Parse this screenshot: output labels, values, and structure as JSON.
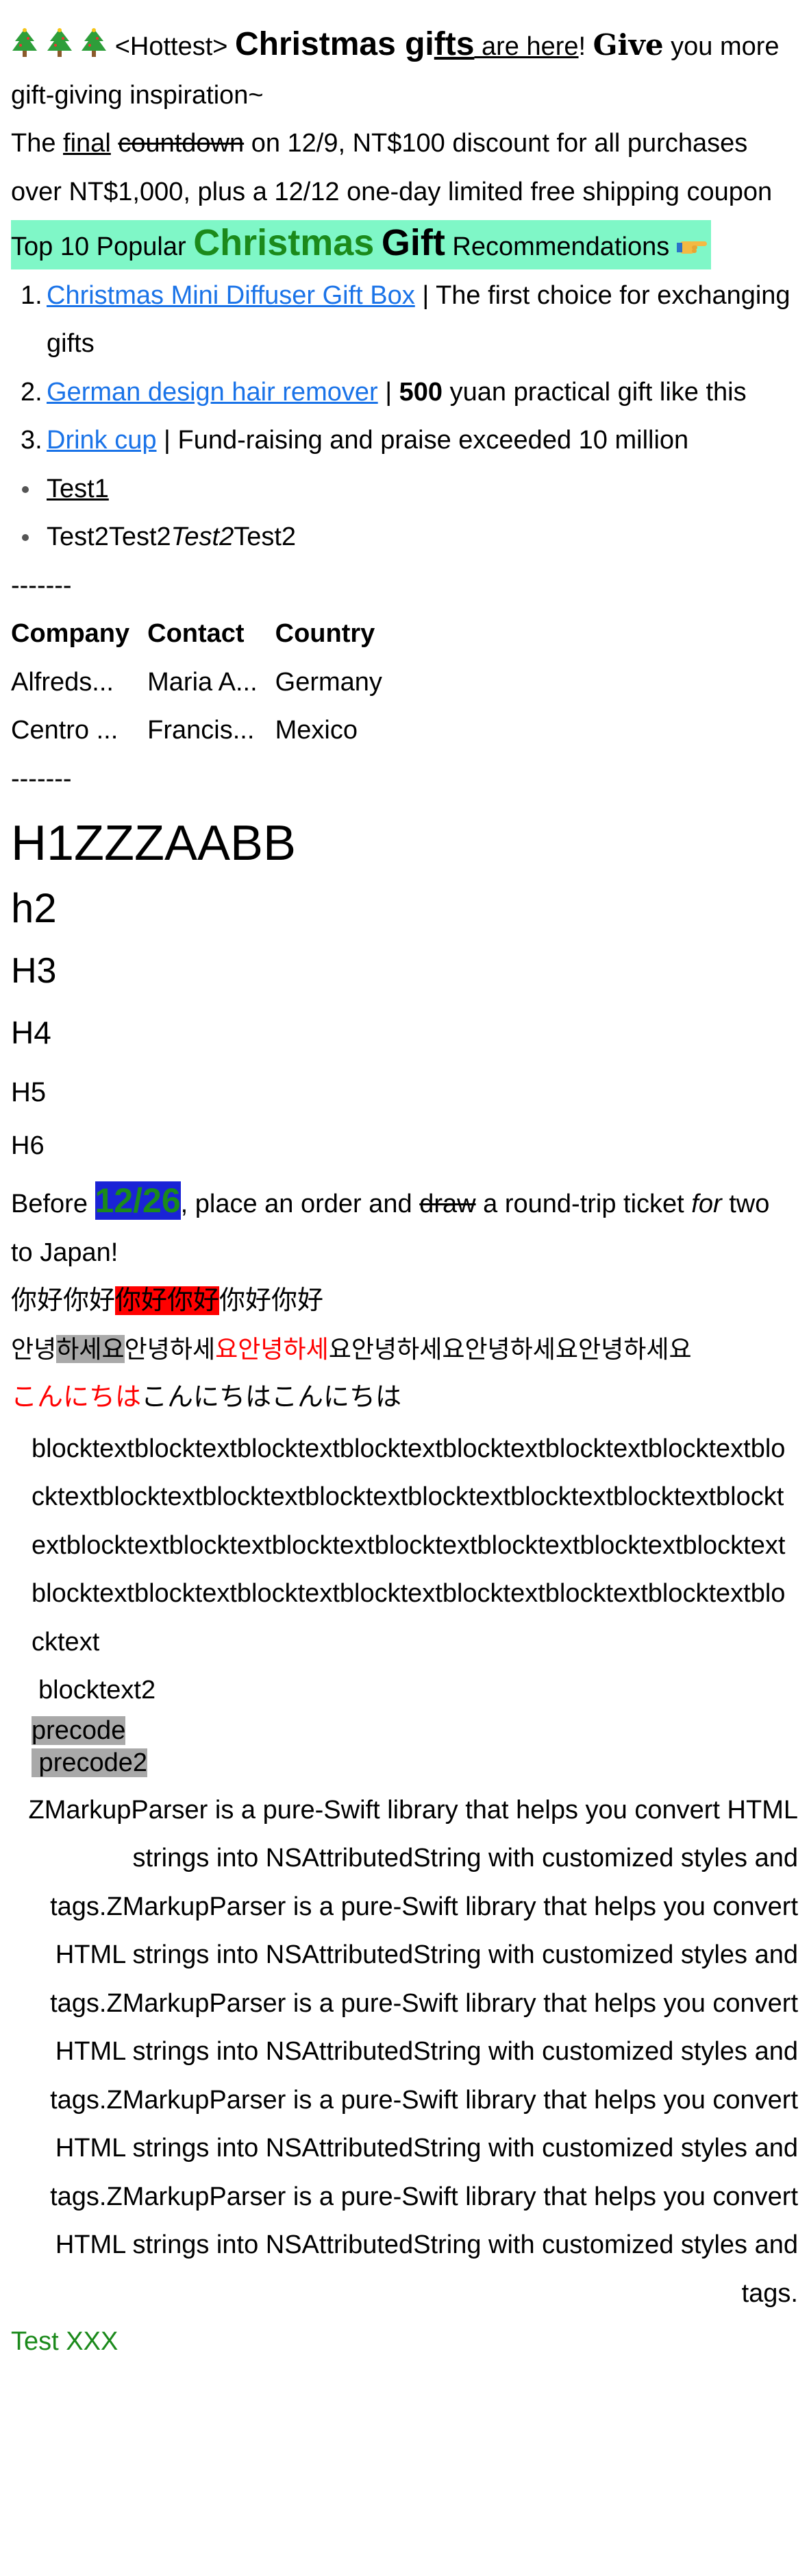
{
  "intro": {
    "icons": [
      "christmas-tree-icon",
      "christmas-tree-icon",
      "christmas-tree-icon"
    ],
    "tag": "<Hottest>",
    "christmas": "Christmas gi",
    "fts": "fts",
    "are_here": " are here",
    "bang": "!",
    "give": "Give",
    "rest": " you more gift-giving inspiration~"
  },
  "countdown": {
    "the": "The ",
    "final": "final",
    "countdown": "countdown",
    "rest": " on 12/9, NT$100 discount for all purchases over NT$1,000, plus a 12/12 one-day limited free shipping coupon"
  },
  "heading_top10": {
    "prefix": "Top 10 Popular ",
    "christmas": "Christmas",
    "gift": "Gift",
    "suffix": " Recommendations ",
    "icon": "pointing-hand-icon",
    "highlight_color": "#7ff7c7"
  },
  "ordered_list": [
    {
      "num": "1.",
      "link": "Christmas Mini Diffuser Gift Box",
      "sep": " | ",
      "text": " The first choice for exchanging gifts",
      "bold": ""
    },
    {
      "num": "2.",
      "link": "German design hair remover",
      "sep": " | ",
      "bold": "500",
      "text": " yuan practical gift like this"
    },
    {
      "num": "3.",
      "link": "Drink cup",
      "sep": " | ",
      "text": " Fund-raising and praise exceeded 10 million",
      "bold": ""
    }
  ],
  "unordered_list": {
    "item1": "Test1",
    "item2_a": "Test2Test2",
    "item2_b": "Test2",
    "item2_c": "Test2"
  },
  "divider": "-------",
  "table": {
    "headers": [
      "Company",
      "Contact",
      "Country"
    ],
    "rows": [
      [
        "Alfreds...",
        "Maria A...",
        "Germany"
      ],
      [
        "Centro ...",
        "Francis...",
        "Mexico"
      ]
    ]
  },
  "headings": {
    "h1": "H1ZZZAABB",
    "h2": "h2",
    "h3": "H3",
    "h4": "H4",
    "h5": "H5",
    "h6": "H6"
  },
  "promo": {
    "before": "Before ",
    "date": "12/26",
    "mid": ", place an order and ",
    "draw": "draw",
    "after": " a round-trip ticket ",
    "for": "for",
    "end": " two to Japan!"
  },
  "chinese": {
    "a": "你好你好",
    "b": "你好你好",
    "c": "你好你好"
  },
  "korean": {
    "a": "안녕",
    "b": "하세요",
    "c": "안녕하세",
    "d": "요안녕하세",
    "e": "요안녕하세요안녕하세요안녕하세요"
  },
  "japanese": {
    "a": "こんにちは",
    "b": "こんにちはこんにちは"
  },
  "blocktext": "blocktextblocktextblocktextblocktextblocktextblocktextblocktextblocktextblocktextblocktextblocktextblocktextblocktextblocktextblocktextblocktextblocktextblocktextblocktextblocktextblocktextblocktextblocktextblocktextblocktextblocktextblocktextblocktextblocktextblocktext",
  "blocktext2": "blocktext2",
  "pre1": "precode",
  "pre2": " precode2",
  "paragraph": "ZMarkupParser is a pure-Swift library that helps you convert HTML strings into NSAttributedString with customized styles and tags.ZMarkupParser is a pure-Swift library that helps you convert HTML strings into NSAttributedString with customized styles and tags.ZMarkupParser is a pure-Swift library that helps you convert HTML strings into NSAttributedString with customized styles and tags.ZMarkupParser is a pure-Swift library that helps you convert HTML strings into NSAttributedString with customized styles and tags.ZMarkupParser is a pure-Swift library that helps you convert HTML strings into NSAttributedString with customized styles and tags.",
  "footer": "Test XXX",
  "colors": {
    "link": "#1a73e8",
    "green": "#1b8a1b",
    "blue_bg": "#1a23d6",
    "red": "#ff0000",
    "gray": "#a9a9a9"
  }
}
